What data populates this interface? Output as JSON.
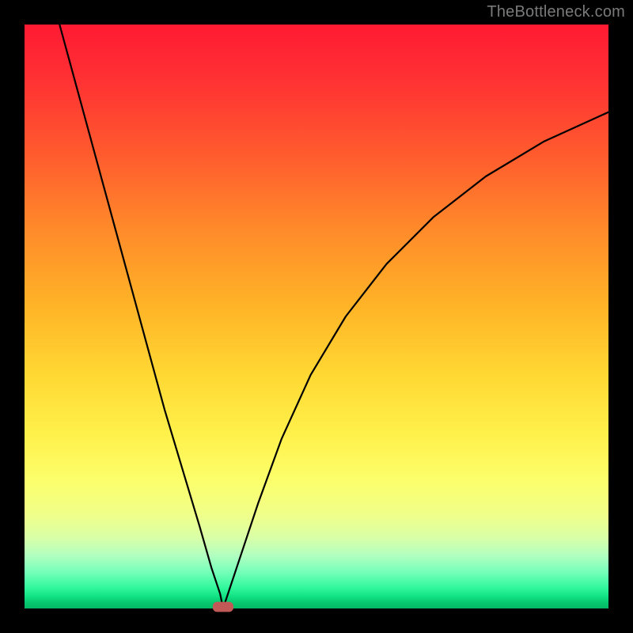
{
  "watermark": {
    "text": "TheBottleneck.com"
  },
  "colors": {
    "frame": "#000000",
    "curve": "#000000",
    "marker": "#c15a56",
    "gradient_top": "#ff1a33",
    "gradient_mid": "#ffe040",
    "gradient_bottom": "#04b862"
  },
  "chart_data": {
    "type": "line",
    "title": "",
    "xlabel": "",
    "ylabel": "",
    "xrange": [
      0,
      100
    ],
    "yrange": [
      0,
      100
    ],
    "grid": false,
    "legend": false,
    "note": "V-shaped curve over a rainbow vertical gradient. Values estimated from pixel positions; no axis ticks or numeric labels are present in the image.",
    "min_point": {
      "x": 34,
      "y": 0
    },
    "series": [
      {
        "name": "left-branch",
        "x": [
          6,
          9,
          12,
          15,
          18,
          21,
          24,
          27,
          30,
          32,
          33.5,
          34
        ],
        "y": [
          100,
          89,
          78,
          67,
          56,
          45,
          34,
          24,
          14,
          7,
          2.5,
          0
        ]
      },
      {
        "name": "right-branch",
        "x": [
          34,
          35,
          37,
          40,
          44,
          49,
          55,
          62,
          70,
          79,
          89,
          100
        ],
        "y": [
          0,
          3,
          9,
          18,
          29,
          40,
          50,
          59,
          67,
          74,
          80,
          85
        ]
      }
    ],
    "marker": {
      "shape": "rounded-rect",
      "x": 34,
      "y": 0,
      "width": 3.4,
      "height": 1.6
    }
  }
}
